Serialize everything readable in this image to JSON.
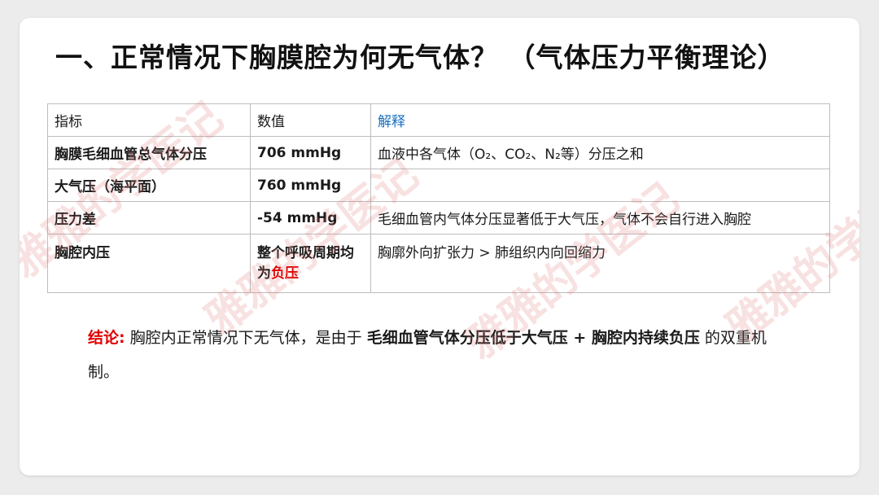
{
  "title": "一、正常情况下胸膜腔为何无气体？ （气体压力平衡理论）",
  "table": {
    "headers": [
      "指标",
      "数值",
      "解释"
    ],
    "rows": [
      {
        "indicator": "胸膜毛细血管总气体分压",
        "value": "706 mmHg",
        "explanation": "血液中各气体（O₂、CO₂、N₂等）分压之和"
      },
      {
        "indicator": "大气压（海平面）",
        "value": "760 mmHg",
        "explanation": ""
      },
      {
        "indicator": "压力差",
        "value": "-54 mmHg",
        "explanation": "毛细血管内气体分压显著低于大气压，气体不会自行进入胸腔"
      },
      {
        "indicator": "胸腔内压",
        "value_prefix": "整个呼吸周期均为",
        "value_highlight": "负压",
        "explanation": "胸廓外向扩张力 > 肺组织内向回缩力"
      }
    ]
  },
  "conclusion": {
    "label": "结论",
    "colon": ":",
    "text_pre": "胸腔内正常情况下无气体，是由于 ",
    "emphasis": "毛细血管气体分压低于大气压 + 胸腔内持续负压",
    "text_post": " 的双重机制。"
  },
  "watermark": "雅雅的学医记",
  "colors": {
    "accent_red": "#e00000",
    "header_blue": "#1a6fc1",
    "background": "#ececec",
    "card": "#ffffff"
  }
}
